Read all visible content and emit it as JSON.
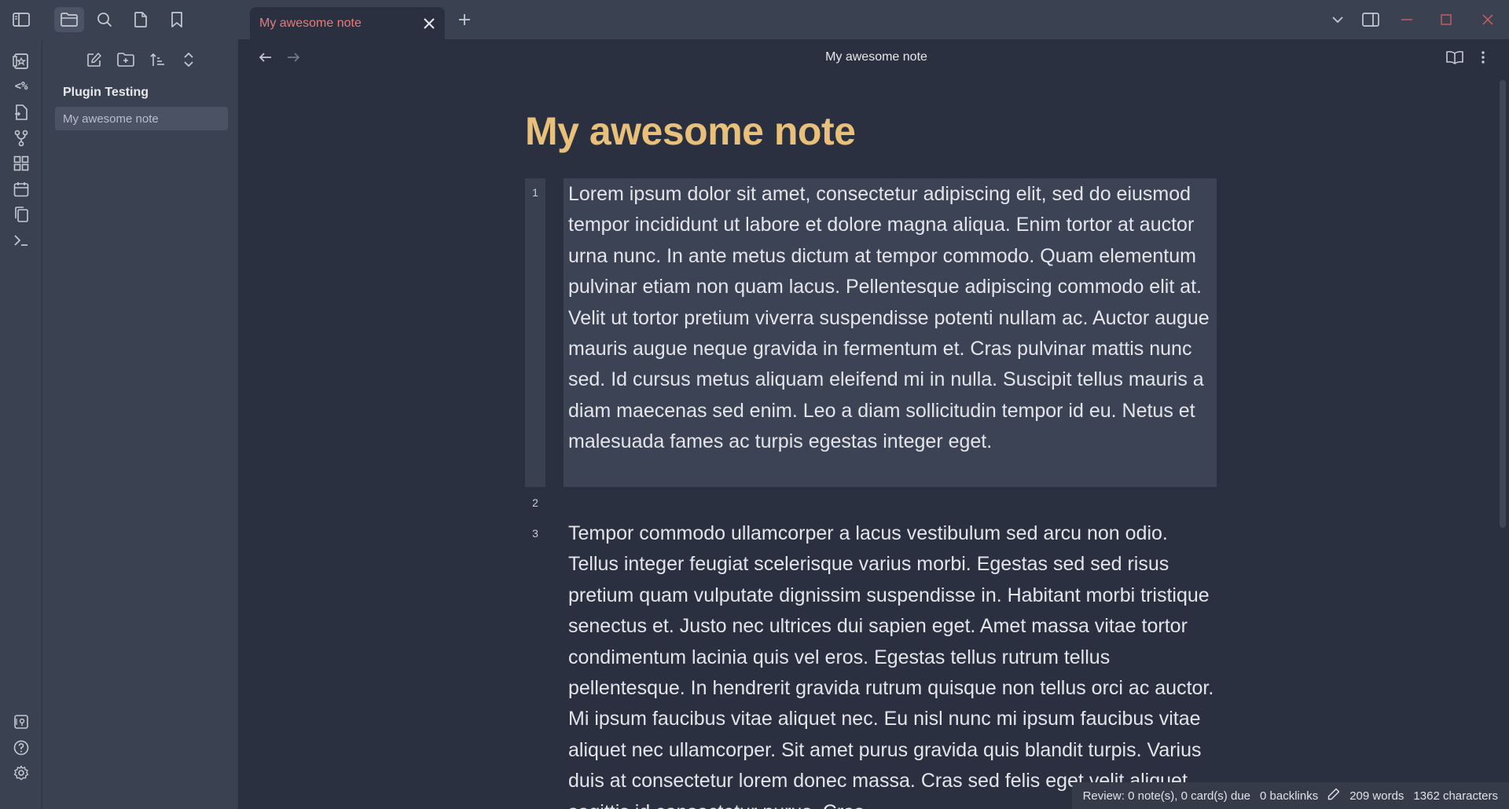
{
  "titlebar": {
    "tab_title": "My awesome note",
    "icons": [
      "sidebar-toggle-icon",
      "folder-icon",
      "search-icon",
      "file-icon",
      "bookmark-icon",
      "close-icon",
      "plus-icon",
      "chevron-down-icon",
      "split-view-icon",
      "minimize-icon",
      "maximize-icon",
      "window-close-icon"
    ]
  },
  "ribbon": {
    "templater_label": "<%",
    "icons": [
      "flashcards-icon",
      "templater-icon",
      "file-switch-icon",
      "git-branch-icon",
      "dashboard-icon",
      "calendar-icon",
      "copy-icon",
      "terminal-icon",
      "vault-icon",
      "help-icon",
      "settings-icon"
    ]
  },
  "explorer": {
    "vault_name": "Plugin Testing",
    "files": [
      {
        "name": "My awesome note",
        "active": true
      }
    ]
  },
  "editor": {
    "header_title": "My awesome note",
    "note_title": "My awesome note",
    "line_numbers": [
      "1",
      "2",
      "3"
    ],
    "paragraphs": [
      "Lorem ipsum dolor sit amet, consectetur adipiscing elit, sed do eiusmod tempor incididunt ut labore et dolore magna aliqua. Enim tortor at auctor urna nunc. In ante metus dictum at tempor commodo. Quam elementum pulvinar etiam non quam lacus. Pellentesque adipiscing commodo elit at. Velit ut tortor pretium viverra suspendisse potenti nullam ac. Auctor augue mauris augue neque gravida in fermentum et. Cras pulvinar mattis nunc sed. Id cursus metus aliquam eleifend mi in nulla. Suscipit tellus mauris a diam maecenas sed enim. Leo a diam sollicitudin tempor id eu. Netus et malesuada fames ac turpis egestas integer eget.",
      "Tempor commodo ullamcorper a lacus vestibulum sed arcu non odio. Tellus integer feugiat scelerisque varius morbi. Egestas sed sed risus pretium quam vulputate dignissim suspendisse in. Habitant morbi tristique senectus et. Justo nec ultrices dui sapien eget. Amet massa vitae tortor condimentum lacinia quis vel eros. Egestas tellus rutrum tellus pellentesque. In hendrerit gravida rutrum quisque non tellus orci ac auctor. Mi ipsum faucibus vitae aliquet nec. Eu nisl nunc mi ipsum faucibus vitae aliquet nec ullamcorper. Sit amet purus gravida quis blandit turpis. Varius duis at consectetur lorem donec massa. Cras sed felis eget velit aliquet sagittis id consectetur purus. Cras"
    ]
  },
  "statusbar": {
    "review": "Review: 0 note(s), 0 card(s) due",
    "backlinks": "0 backlinks",
    "words": "209 words",
    "characters": "1362 characters"
  },
  "colors": {
    "accent_title": "#e8c07a",
    "tab_title": "#e87a7a",
    "background": "#2b3040",
    "sidebar": "#3a4150"
  }
}
